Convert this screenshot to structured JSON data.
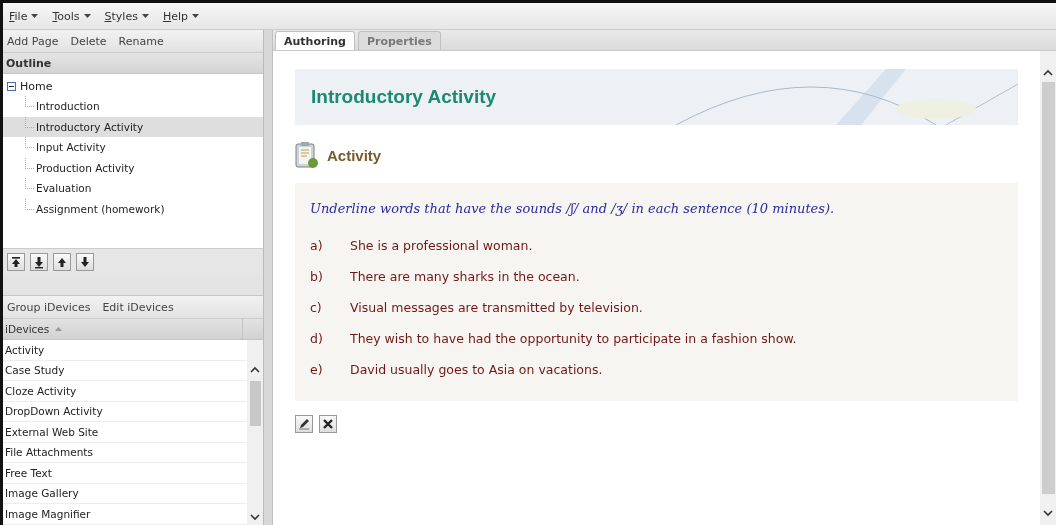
{
  "menu": [
    "File",
    "Tools",
    "Styles",
    "Help"
  ],
  "outline_toolbar": [
    "Add Page",
    "Delete",
    "Rename"
  ],
  "outline": {
    "title": "Outline",
    "items": [
      {
        "label": "Home",
        "expanded": true,
        "selected": false,
        "children": [
          {
            "label": "Introduction",
            "selected": false
          },
          {
            "label": "Introductory Activity",
            "selected": true
          },
          {
            "label": "Input Activity",
            "selected": false
          },
          {
            "label": "Production Activity",
            "selected": false
          },
          {
            "label": "Evaluation",
            "selected": false
          },
          {
            "label": "Assignment (homework)",
            "selected": false
          }
        ]
      }
    ]
  },
  "idevices_toolbar": [
    "Group iDevices",
    "Edit iDevices"
  ],
  "idevices": {
    "column": "iDevices",
    "items": [
      "Activity",
      "Case Study",
      "Cloze Activity",
      "DropDown Activity",
      "External Web Site",
      "File Attachments",
      "Free Text",
      "Image Gallery",
      "Image Magnifier"
    ]
  },
  "tabs": [
    {
      "label": "Authoring",
      "selected": true
    },
    {
      "label": "Properties",
      "selected": false
    }
  ],
  "page_title": "Introductory Activity",
  "idevice": {
    "title": "Activity",
    "instruction": "Underline words that have the sounds /ʃ/ and /ʒ/ in each sentence (10 minutes).",
    "items": [
      {
        "letter": "a)",
        "text": "She is a professional woman."
      },
      {
        "letter": "b)",
        "text": "There are many sharks in the ocean."
      },
      {
        "letter": "c)",
        "text": "Visual messages are transmitted by television."
      },
      {
        "letter": "d)",
        "text": "They wish to have had the opportunity to participate in a fashion show."
      },
      {
        "letter": "e)",
        "text": "David usually goes to Asia on vacations."
      }
    ]
  }
}
